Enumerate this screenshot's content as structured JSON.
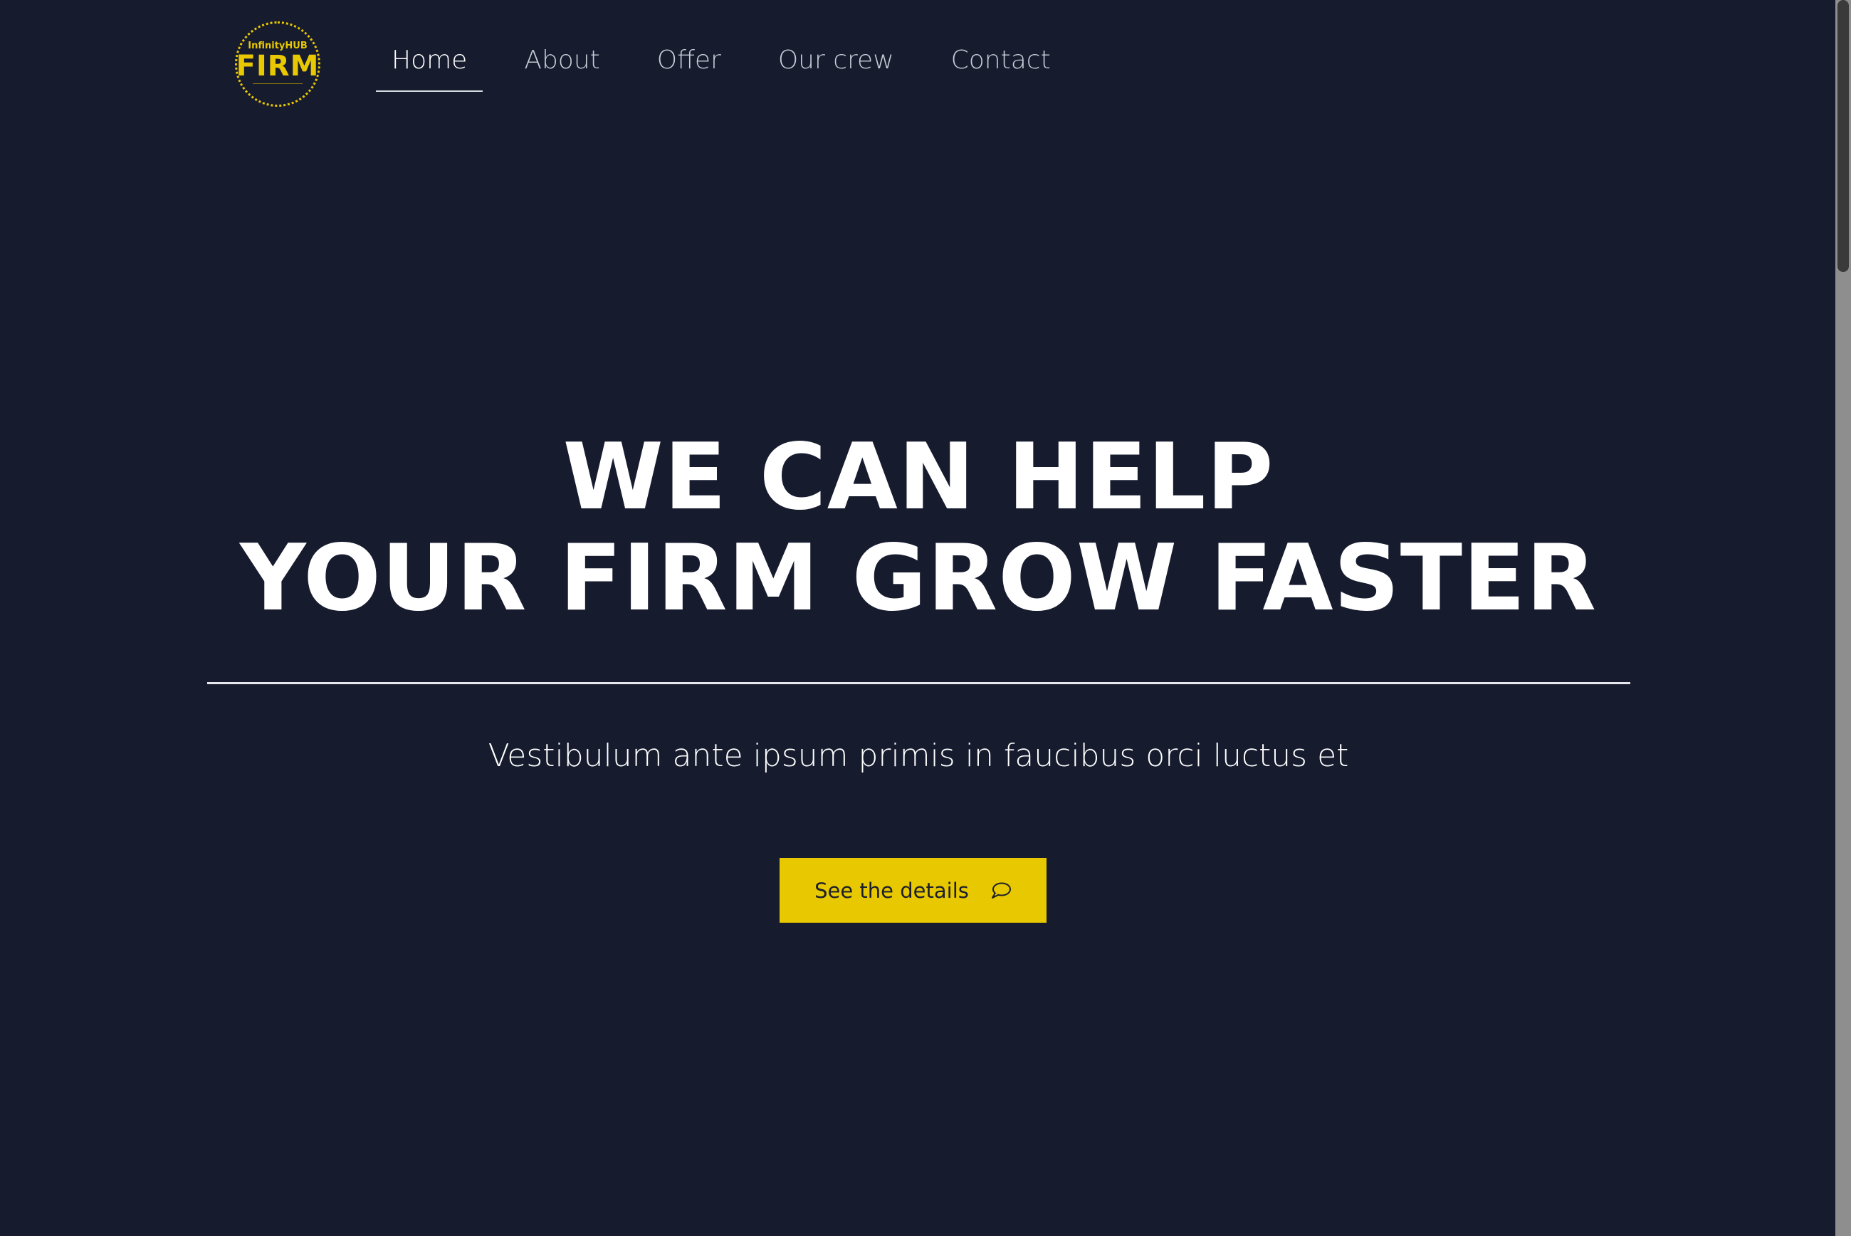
{
  "brand": {
    "logo_small_text": "InfinityHUB",
    "logo_main_text": "FIRM",
    "accent_color": "#e8c800",
    "background_color": "#161b2e"
  },
  "nav": {
    "items": [
      {
        "label": "Home",
        "active": true
      },
      {
        "label": "About",
        "active": false
      },
      {
        "label": "Offer",
        "active": false
      },
      {
        "label": "Our crew",
        "active": false
      },
      {
        "label": "Contact",
        "active": false
      }
    ]
  },
  "hero": {
    "title_line_1": "WE CAN HELP",
    "title_line_2": "YOUR FIRM GROW FASTER",
    "subtitle": "Vestibulum ante ipsum primis in faucibus orci luctus et",
    "cta_label": "See the details",
    "cta_icon": "speech-bubble-icon"
  }
}
